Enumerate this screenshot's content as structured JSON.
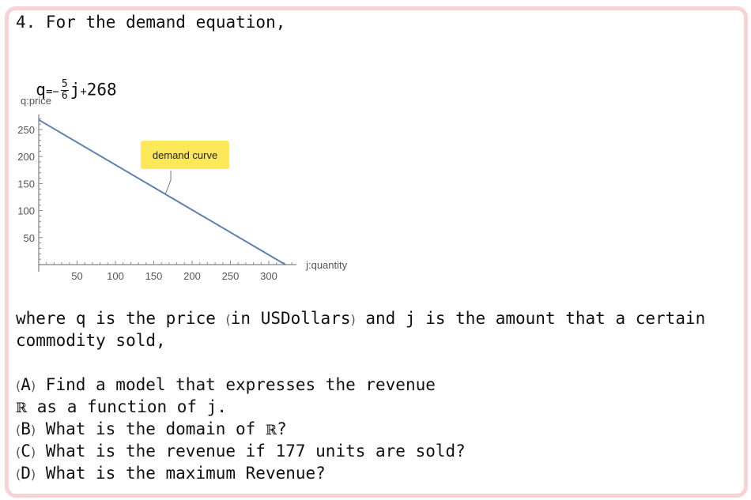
{
  "question": {
    "heading": "4. For the demand equation,",
    "equation": {
      "lhs": "q",
      "eq": "=",
      "minus": "−",
      "num": "5",
      "den": "6",
      "var": "j",
      "plus": "+",
      "const": "268"
    },
    "where_line1": {
      "pre": "where q is the price ",
      "open": "(",
      "unit": "in USDollars",
      "close": ")",
      "post": " and j is the amount that a certain"
    },
    "where_line2": "commodity sold,",
    "a_line1": {
      "label": "A",
      "text": " Find a model that expresses the revenue"
    },
    "a_line2": {
      "sym": "ℝ",
      "text": " as a function of j."
    },
    "b_line": {
      "label": "B",
      "text": " What is the domain of ",
      "sym": "ℝ",
      "end": "?"
    },
    "c_line": {
      "label": "C",
      "text": " What is the revenue if 177 units are sold?"
    },
    "d_line": {
      "label": "D",
      "text": " What is the maximum Revenue?"
    }
  },
  "chart_data": {
    "type": "line",
    "xlabel": "j:quantity",
    "ylabel": "q:price",
    "xlim": [
      0,
      330
    ],
    "ylim": [
      0,
      275
    ],
    "xticks": [
      50,
      100,
      150,
      200,
      250,
      300
    ],
    "yticks": [
      50,
      100,
      150,
      200,
      250
    ],
    "series": [
      {
        "x": [
          0,
          321.6
        ],
        "y": [
          268,
          0
        ],
        "color": "#5b7fb0"
      }
    ],
    "annotation": {
      "text": "demand curve",
      "x": 165,
      "y": 130,
      "color": "#fde85a"
    }
  }
}
